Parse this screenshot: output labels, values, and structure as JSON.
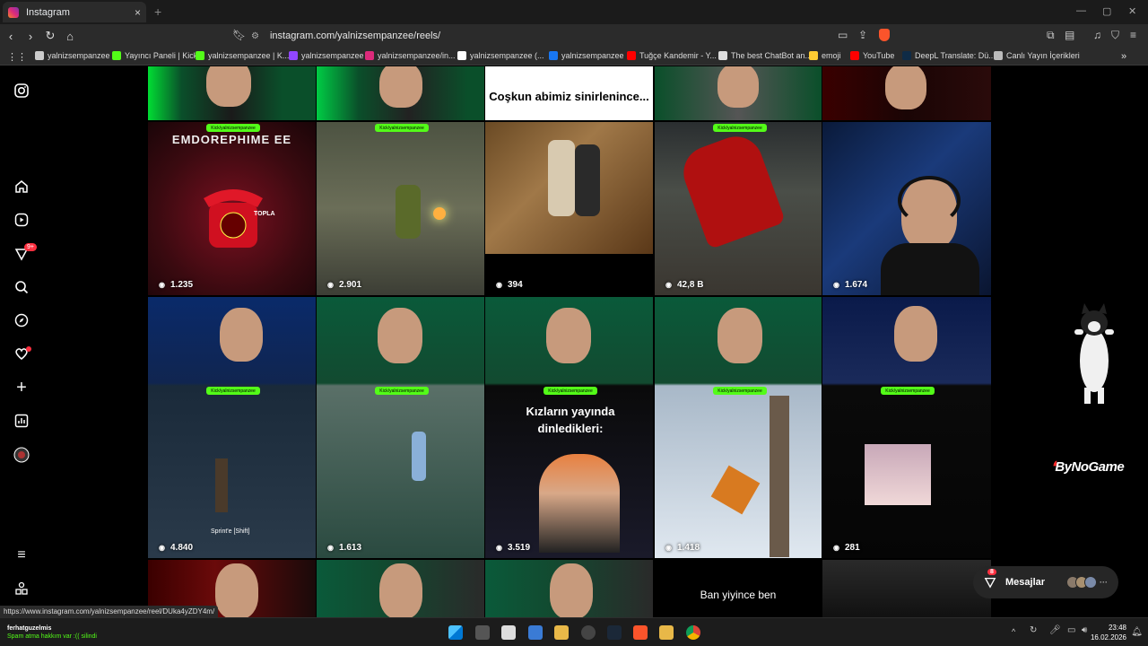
{
  "browser": {
    "tab_title": "Instagram",
    "tab_close": "×",
    "new_tab": "+",
    "url": "instagram.com/yalnizsempanzee/reels/",
    "bookmarks": [
      {
        "label": "yalnizsempanzee",
        "color": "#cccccc"
      },
      {
        "label": "Yayıncı Paneli | Kick",
        "color": "#53fc18"
      },
      {
        "label": "yalnizsempanzee | K...",
        "color": "#53fc18"
      },
      {
        "label": "yalnizsempanzee",
        "color": "#9146ff"
      },
      {
        "label": "yalnizsempanzee/in...",
        "color": "#dd2a7b"
      },
      {
        "label": "yalnizsempanzee (...",
        "color": "#ffffff"
      },
      {
        "label": "yalnizsempanzee",
        "color": "#1877f2"
      },
      {
        "label": "Tuğçe Kandemir - Y...",
        "color": "#ff0000"
      },
      {
        "label": "The best ChatBot an...",
        "color": "#dddddd"
      },
      {
        "label": "emoji",
        "color": "#ffcc33"
      },
      {
        "label": "YouTube",
        "color": "#ff0000"
      },
      {
        "label": "DeepL Translate: Dü...",
        "color": "#0f2b46"
      },
      {
        "label": "Canlı Yayın İçerikleri",
        "color": "#bbbbbb"
      }
    ],
    "status_url": "https://www.instagram.com/yalnizsempanzee/reel/DUka4yZDY4m/"
  },
  "leftnav": {
    "notification_badge": "9+"
  },
  "reels": [
    {
      "views": "1.235",
      "overlay": "EMDOREPHIME EE",
      "sub": "TOPLA"
    },
    {
      "views": "2.901"
    },
    {
      "views": "394",
      "caption": "Coşkun abimiz sinirlenince..."
    },
    {
      "views": "42,8 B"
    },
    {
      "views": "1.674"
    },
    {
      "views": "4.840",
      "sub": "Sprint'e [Shift]"
    },
    {
      "views": "1.613"
    },
    {
      "views": "3.519",
      "caption": "Kızların yayında dinledikleri:"
    },
    {
      "views": "1.418"
    },
    {
      "views": "281"
    },
    {
      "caption": "Ban yiyince ben"
    }
  ],
  "kick_banner": "Kick/yalnizsempanzee",
  "sponsor": "ByNoGame",
  "messages": {
    "label": "Mesajlar",
    "badge": "8",
    "more": "···"
  },
  "taskbar": {
    "notif_user": "ferhatguzelmis",
    "notif_text": "Spam atma hakkım var :(( silindi",
    "time": "23:48",
    "date": "16.02.2026"
  },
  "colors": {
    "kick_green": "#53fc18",
    "instagram_red": "#ff3040",
    "brave_orange": "#fb542b"
  }
}
